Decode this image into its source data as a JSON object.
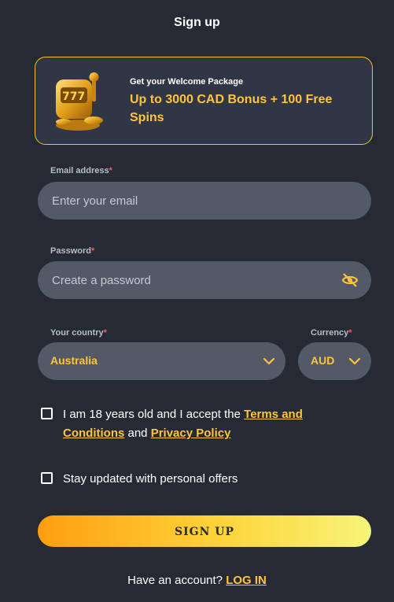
{
  "page": {
    "title": "Sign up"
  },
  "promo": {
    "subtitle": "Get your Welcome Package",
    "headline": "Up to 3000 CAD Bonus + 100 Free Spins",
    "art_icon": "slot-machine-icon"
  },
  "form": {
    "email": {
      "label": "Email address",
      "required_mark": "*",
      "placeholder": "Enter your email",
      "value": ""
    },
    "password": {
      "label": "Password",
      "required_mark": "*",
      "placeholder": "Create a password",
      "value": "",
      "toggle_icon": "eye-off-icon"
    },
    "country": {
      "label": "Your country",
      "required_mark": "*",
      "value": "Australia"
    },
    "currency": {
      "label": "Currency",
      "required_mark": "*",
      "value": "AUD"
    },
    "terms": {
      "text_before": "I am 18 years old and I accept the ",
      "terms_link": "Terms and Conditions",
      "text_middle": " and ",
      "privacy_link": "Privacy Policy"
    },
    "offers": {
      "text": "Stay updated with personal offers"
    },
    "submit_label": "SIGN UP"
  },
  "footer": {
    "have_account": "Have an account? ",
    "login_link": "LOG IN"
  },
  "colors": {
    "background": "#262a34",
    "accent": "#ffc53a",
    "field": "#535966",
    "required": "#ff5a5a"
  }
}
